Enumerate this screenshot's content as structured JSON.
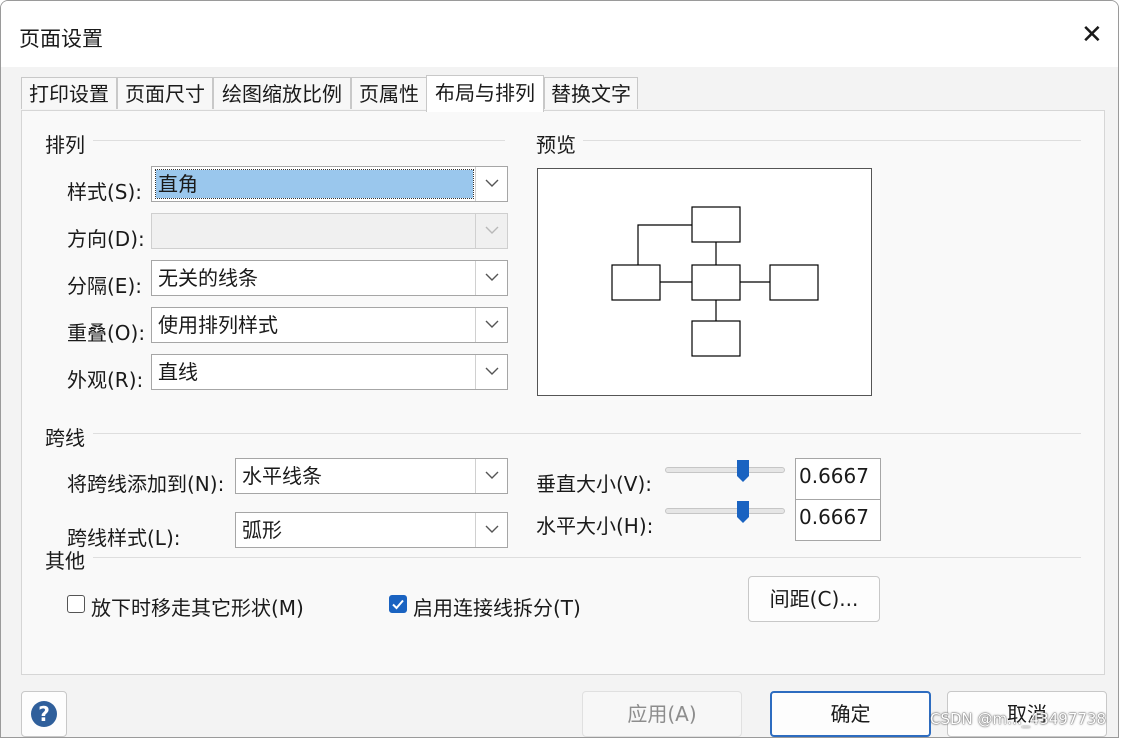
{
  "window": {
    "title": "页面设置",
    "close_glyph": "✕"
  },
  "tabs": [
    "打印设置",
    "页面尺寸",
    "绘图缩放比例",
    "页属性",
    "布局与排列",
    "替换文字"
  ],
  "active_tab": "布局与排列",
  "layout_group": {
    "title": "排列",
    "style_label": "样式(S):",
    "style_value": "直角",
    "direction_label": "方向(D):",
    "direction_value": "",
    "separation_label": "分隔(E):",
    "separation_value": "无关的线条",
    "overlap_label": "重叠(O):",
    "overlap_value": "使用排列样式",
    "appearance_label": "外观(R):",
    "appearance_value": "直线"
  },
  "preview_group": {
    "title": "预览"
  },
  "jumps_group": {
    "title": "跨线",
    "add_to_label": "将跨线添加到(N):",
    "add_to_value": "水平线条",
    "style_label": "跨线样式(L):",
    "style_value": "弧形",
    "vertical_label": "垂直大小(V):",
    "vertical_value": "0.6667",
    "vertical_level": 0.65,
    "horizontal_label": "水平大小(H):",
    "horizontal_value": "0.6667",
    "horizontal_level": 0.65
  },
  "other_group": {
    "title": "其他",
    "move_shapes_label": "放下时移走其它形状(M)",
    "move_shapes_checked": false,
    "split_connectors_label": "启用连接线拆分(T)",
    "split_connectors_checked": true,
    "spacing_button": "间距(C)..."
  },
  "footer": {
    "help_glyph": "?",
    "apply": "应用(A)",
    "ok": "确定",
    "cancel": "取消"
  },
  "watermark": "CSDN @m…_43497738",
  "colors": {
    "accent": "#1a63c1",
    "selection": "#9ac7ed"
  }
}
